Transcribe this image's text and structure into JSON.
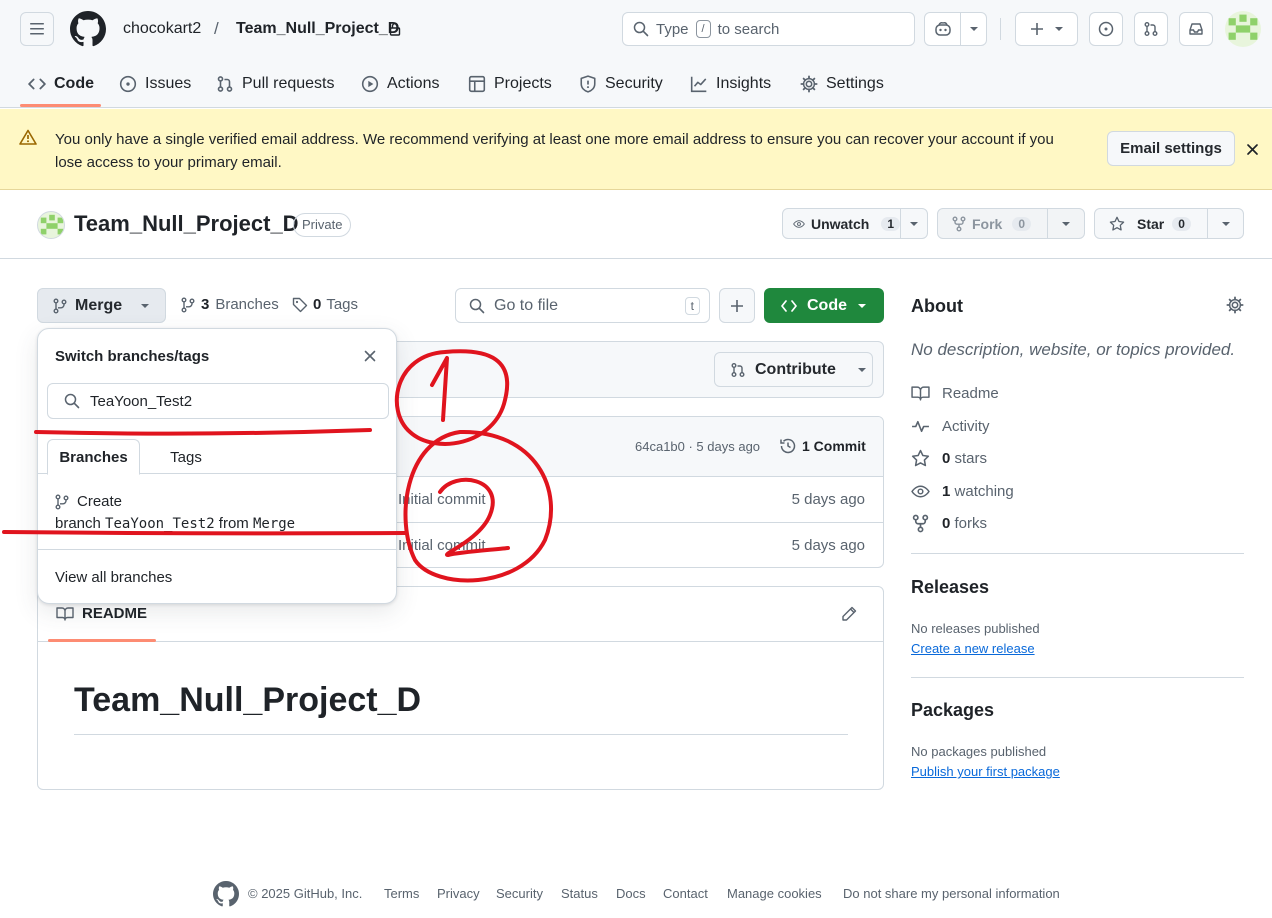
{
  "header": {
    "owner": "chocokart2",
    "separator": "/",
    "repo": "Team_Null_Project_D",
    "search_type": "Type",
    "search_key": "/",
    "search_suffix": "to search"
  },
  "nav": {
    "tabs": [
      {
        "label": "Code"
      },
      {
        "label": "Issues"
      },
      {
        "label": "Pull requests"
      },
      {
        "label": "Actions"
      },
      {
        "label": "Projects"
      },
      {
        "label": "Security"
      },
      {
        "label": "Insights"
      },
      {
        "label": "Settings"
      }
    ]
  },
  "banner": {
    "line1": "You only have a single verified email address. We recommend verifying at least one more email address to ensure you can recover your account if you",
    "line2": "lose access to your primary email.",
    "button": "Email settings"
  },
  "repo_header": {
    "title": "Team_Null_Project_D",
    "visibility": "Private",
    "unwatch_label": "Unwatch",
    "unwatch_count": "1",
    "fork_label": "Fork",
    "fork_count": "0",
    "star_label": "Star",
    "star_count": "0"
  },
  "toolbar": {
    "branch": "Merge",
    "branches_count": "3",
    "branches_label": "Branches",
    "tags_count": "0",
    "tags_label": "Tags",
    "goto_placeholder": "Go to file",
    "goto_key": "t",
    "code_button": "Code"
  },
  "contribute": "Contribute",
  "commit_bar": {
    "hash_time": "64ca1b0 · 5 days ago",
    "commits": "1 Commit"
  },
  "files": [
    {
      "message": "Initial commit",
      "time": "5 days ago"
    },
    {
      "message": "Initial commit",
      "time": "5 days ago"
    }
  ],
  "readme": {
    "tab": "README",
    "heading": "Team_Null_Project_D"
  },
  "dropdown": {
    "title": "Switch branches/tags",
    "search_value": "TeaYoon_Test2",
    "tabs": [
      "Branches",
      "Tags"
    ],
    "create_line1": "Create",
    "create_prefix": "branch",
    "create_branch": "TeaYoon_Test2",
    "create_from": "from",
    "create_base": "Merge",
    "view_all": "View all branches"
  },
  "about": {
    "title": "About",
    "description": "No description, website, or topics provided.",
    "readme": "Readme",
    "activity": "Activity",
    "stars_num": "0",
    "stars_label": "stars",
    "watching_num": "1",
    "watching_label": "watching",
    "forks_num": "0",
    "forks_label": "forks"
  },
  "releases": {
    "title": "Releases",
    "empty": "No releases published",
    "link": "Create a new release"
  },
  "packages": {
    "title": "Packages",
    "empty": "No packages published",
    "link": "Publish your first package"
  },
  "footer": {
    "copyright": "© 2025 GitHub, Inc.",
    "links": [
      "Terms",
      "Privacy",
      "Security",
      "Status",
      "Docs",
      "Contact",
      "Manage cookies",
      "Do not share my personal information"
    ]
  },
  "annotations": {
    "marks": [
      "1",
      "2"
    ],
    "color": "#e0141e"
  },
  "colors": {
    "accent_tab": "#fd8c73",
    "code_button": "#1f883d",
    "link": "#0969da",
    "banner": "#fff8c5"
  }
}
